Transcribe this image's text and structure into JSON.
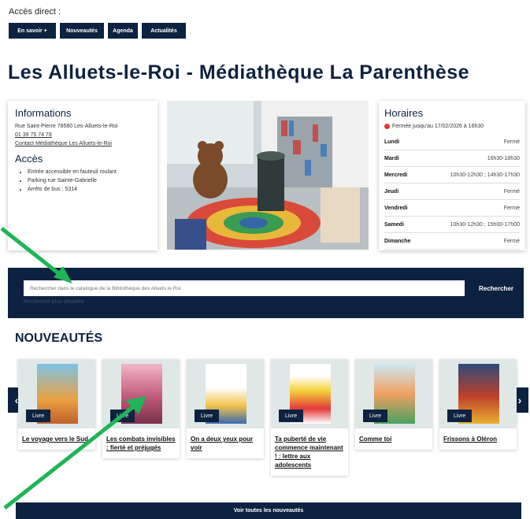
{
  "quick_access": {
    "label": "Accès direct :",
    "buttons": [
      "En savoir +",
      "Nouveautés",
      "Agenda",
      "Actualités"
    ]
  },
  "page_title": "Les Alluets-le-Roi - Médiathèque La Parenthèse",
  "info": {
    "heading": "Informations",
    "address": "Rue Saint-Pierre 78580 Les-Alluets-le-Roi",
    "phone": "01 39 75 74 78",
    "contact": "Contact Médiathèque Les Alluets-le-Roi",
    "access_heading": "Accès",
    "access_items": [
      "Entrée accessible en fauteuil roulant",
      "Parking rue Sainte-Gabrielle",
      "Arrêts de bus : 5314"
    ]
  },
  "hours": {
    "heading": "Horaires",
    "status": "Fermée jusqu'au 17/02/2026 à 16h30",
    "status_color": "#e53935",
    "days": [
      {
        "day": "Lundi",
        "hours": "Fermé"
      },
      {
        "day": "Mardi",
        "hours": "16h30-18h30"
      },
      {
        "day": "Mercredi",
        "hours": "10h30-12h30 ; 14h30-17h30"
      },
      {
        "day": "Jeudi",
        "hours": "Fermé"
      },
      {
        "day": "Vendredi",
        "hours": "Fermé"
      },
      {
        "day": "Samedi",
        "hours": "10h30-12h30 ; 15h00-17h00"
      },
      {
        "day": "Dimanche",
        "hours": "Fermé"
      }
    ]
  },
  "search": {
    "placeholder": "Rechercher dans le catalogue de la Bibliothèque des Alluets le Roi",
    "button": "Rechercher",
    "advanced": "Recherche plus détaillée"
  },
  "news": {
    "heading": "NOUVEAUTÉS",
    "books": [
      {
        "badge": "Livre",
        "title": "Le voyage vers le Sud"
      },
      {
        "badge": "Livre",
        "title": "Les combats invisibles : fierté et préjugés"
      },
      {
        "badge": "Livre",
        "title": "On a deux yeux pour voir"
      },
      {
        "badge": "Livre",
        "title": "Ta puberté de vie commence maintenant ! : lettre aux adolescents"
      },
      {
        "badge": "Livre",
        "title": "Comme toi"
      },
      {
        "badge": "Livre",
        "title": "Frissons à Oléron"
      }
    ],
    "see_all": "Voir toutes les nouveautés"
  },
  "colors": {
    "navy": "#0d2240",
    "arrow": "#1fb556"
  }
}
